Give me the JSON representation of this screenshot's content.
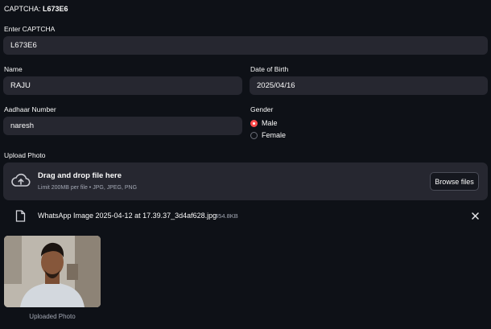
{
  "captcha": {
    "label": "CAPTCHA:",
    "code": "L673E6"
  },
  "captcha_input": {
    "label": "Enter CAPTCHA",
    "value": "L673E6"
  },
  "name": {
    "label": "Name",
    "value": "RAJU"
  },
  "dob": {
    "label": "Date of Birth",
    "value": "2025/04/16"
  },
  "aadhaar": {
    "label": "Aadhaar Number",
    "value": "naresh"
  },
  "gender": {
    "label": "Gender",
    "options": [
      "Male",
      "Female"
    ],
    "selected": "Male"
  },
  "upload": {
    "label": "Upload Photo",
    "title": "Drag and drop file here",
    "limit": "Limit 200MB per file • JPG, JPEG, PNG",
    "browse_label": "Browse files",
    "icon": "cloud-upload-icon"
  },
  "file": {
    "name": "WhatsApp Image 2025-04-12 at 17.39.37_3d4af628.jpg",
    "size": "454.8KB",
    "icon": "file-icon"
  },
  "photo": {
    "caption": "Uploaded Photo"
  },
  "colors": {
    "background": "#0e1117",
    "input": "#262730",
    "accent": "#ff4b4b"
  }
}
